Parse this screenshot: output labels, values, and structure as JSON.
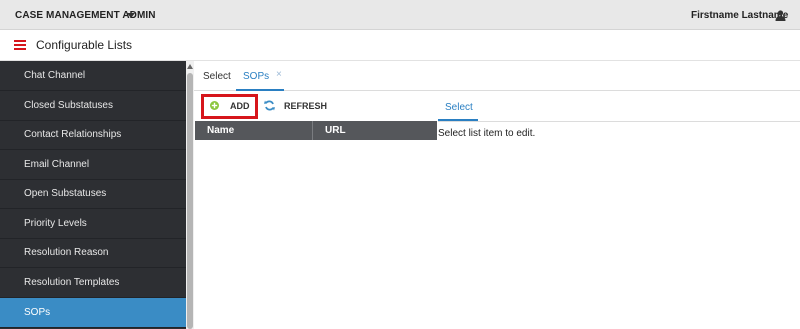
{
  "header": {
    "app_title": "CASE MANAGEMENT ADMIN",
    "user_name": "Firstname Lastname",
    "icons": {
      "caret": "caret-down-icon",
      "user": "user-icon"
    }
  },
  "page": {
    "title": "Configurable Lists",
    "menu_icon": "hamburger-menu-icon",
    "menu_icon_color": "#d6151b"
  },
  "sidebar": {
    "items": [
      {
        "label": "Chat Channel",
        "active": false
      },
      {
        "label": "Closed Substatuses",
        "active": false
      },
      {
        "label": "Contact Relationships",
        "active": false
      },
      {
        "label": "Email Channel",
        "active": false
      },
      {
        "label": "Open Substatuses",
        "active": false
      },
      {
        "label": "Priority Levels",
        "active": false
      },
      {
        "label": "Resolution Reason",
        "active": false
      },
      {
        "label": "Resolution Templates",
        "active": false
      },
      {
        "label": "SOPs",
        "active": true
      }
    ],
    "background": "#2d2f33",
    "active_color": "#3a8cc5"
  },
  "tabs": {
    "items": [
      {
        "label": "Select",
        "active": false
      },
      {
        "label": "SOPs",
        "active": true,
        "closable": true
      }
    ],
    "close_glyph": "×",
    "accent": "#2a7fc2"
  },
  "toolbar": {
    "add_label": "ADD",
    "refresh_label": "REFRESH",
    "add_icon": "add-circle-icon",
    "refresh_icon": "refresh-icon",
    "highlight_color": "#d6151b"
  },
  "grid": {
    "columns": [
      "Name",
      "URL"
    ],
    "rows": []
  },
  "edit_panel": {
    "tab_label": "Select",
    "message": "Select list item to edit."
  }
}
